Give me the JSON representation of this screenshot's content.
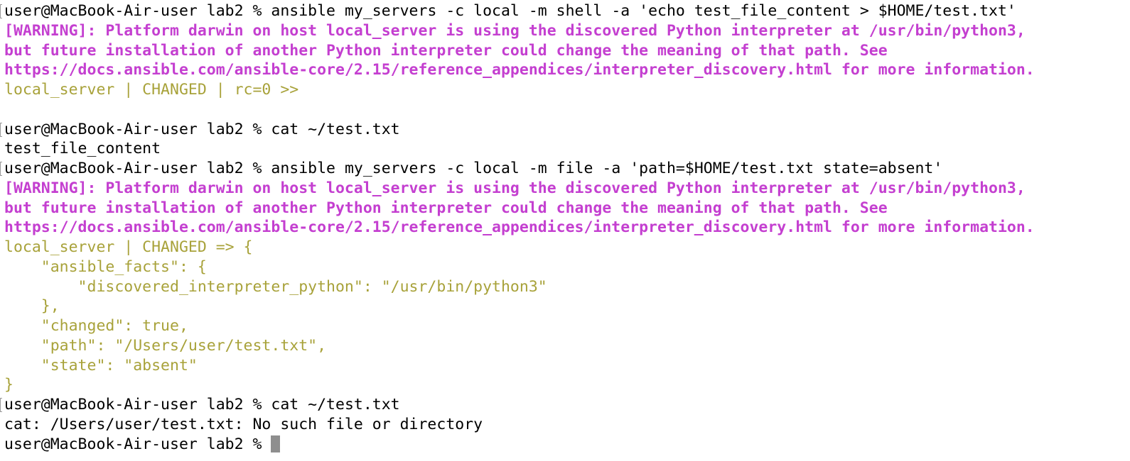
{
  "terminal": {
    "lines": [
      {
        "segments": [
          {
            "style": "prompt",
            "text": "user@MacBook-Air-user lab2 % "
          },
          {
            "style": "cmd",
            "text": "ansible my_servers -c local -m shell -a 'echo test_file_content > $HOME/test.txt'"
          }
        ],
        "marked": true
      },
      {
        "segments": [
          {
            "style": "warn",
            "text": "[WARNING]: Platform darwin on host local_server is using the discovered Python interpreter at /usr/bin/python3,"
          }
        ]
      },
      {
        "segments": [
          {
            "style": "warn",
            "text": "but future installation of another Python interpreter could change the meaning of that path. See"
          }
        ]
      },
      {
        "segments": [
          {
            "style": "warn",
            "text": "https://docs.ansible.com/ansible-core/2.15/reference_appendices/interpreter_discovery.html for more information."
          }
        ]
      },
      {
        "segments": [
          {
            "style": "ok",
            "text": "local_server | CHANGED | rc=0 >>"
          }
        ]
      },
      {
        "segments": [
          {
            "style": "out",
            "text": ""
          }
        ]
      },
      {
        "segments": [
          {
            "style": "prompt",
            "text": "user@MacBook-Air-user lab2 % "
          },
          {
            "style": "cmd",
            "text": "cat ~/test.txt"
          }
        ],
        "marked": true
      },
      {
        "segments": [
          {
            "style": "out",
            "text": "test_file_content"
          }
        ]
      },
      {
        "segments": [
          {
            "style": "prompt",
            "text": "user@MacBook-Air-user lab2 % "
          },
          {
            "style": "cmd",
            "text": "ansible my_servers -c local -m file -a 'path=$HOME/test.txt state=absent'"
          }
        ],
        "marked": true
      },
      {
        "segments": [
          {
            "style": "warn",
            "text": "[WARNING]: Platform darwin on host local_server is using the discovered Python interpreter at /usr/bin/python3,"
          }
        ]
      },
      {
        "segments": [
          {
            "style": "warn",
            "text": "but future installation of another Python interpreter could change the meaning of that path. See"
          }
        ]
      },
      {
        "segments": [
          {
            "style": "warn",
            "text": "https://docs.ansible.com/ansible-core/2.15/reference_appendices/interpreter_discovery.html for more information."
          }
        ]
      },
      {
        "segments": [
          {
            "style": "ok",
            "text": "local_server | CHANGED => {"
          }
        ]
      },
      {
        "segments": [
          {
            "style": "ok",
            "text": "    \"ansible_facts\": {"
          }
        ]
      },
      {
        "segments": [
          {
            "style": "ok",
            "text": "        \"discovered_interpreter_python\": \"/usr/bin/python3\""
          }
        ]
      },
      {
        "segments": [
          {
            "style": "ok",
            "text": "    },"
          }
        ]
      },
      {
        "segments": [
          {
            "style": "ok",
            "text": "    \"changed\": true,"
          }
        ]
      },
      {
        "segments": [
          {
            "style": "ok",
            "text": "    \"path\": \"/Users/user/test.txt\","
          }
        ]
      },
      {
        "segments": [
          {
            "style": "ok",
            "text": "    \"state\": \"absent\""
          }
        ]
      },
      {
        "segments": [
          {
            "style": "ok",
            "text": "}"
          }
        ]
      },
      {
        "segments": [
          {
            "style": "prompt",
            "text": "user@MacBook-Air-user lab2 % "
          },
          {
            "style": "cmd",
            "text": "cat ~/test.txt"
          }
        ],
        "marked": true
      },
      {
        "segments": [
          {
            "style": "out",
            "text": "cat: /Users/user/test.txt: No such file or directory"
          }
        ]
      },
      {
        "segments": [
          {
            "style": "prompt",
            "text": "user@MacBook-Air-user lab2 % "
          }
        ],
        "cursor": true
      }
    ]
  },
  "colors": {
    "warning": "#c43fd0",
    "ansible_output": "#a8a23a",
    "text": "#000000",
    "cursor": "#8e8e8e",
    "background": "#ffffff"
  }
}
